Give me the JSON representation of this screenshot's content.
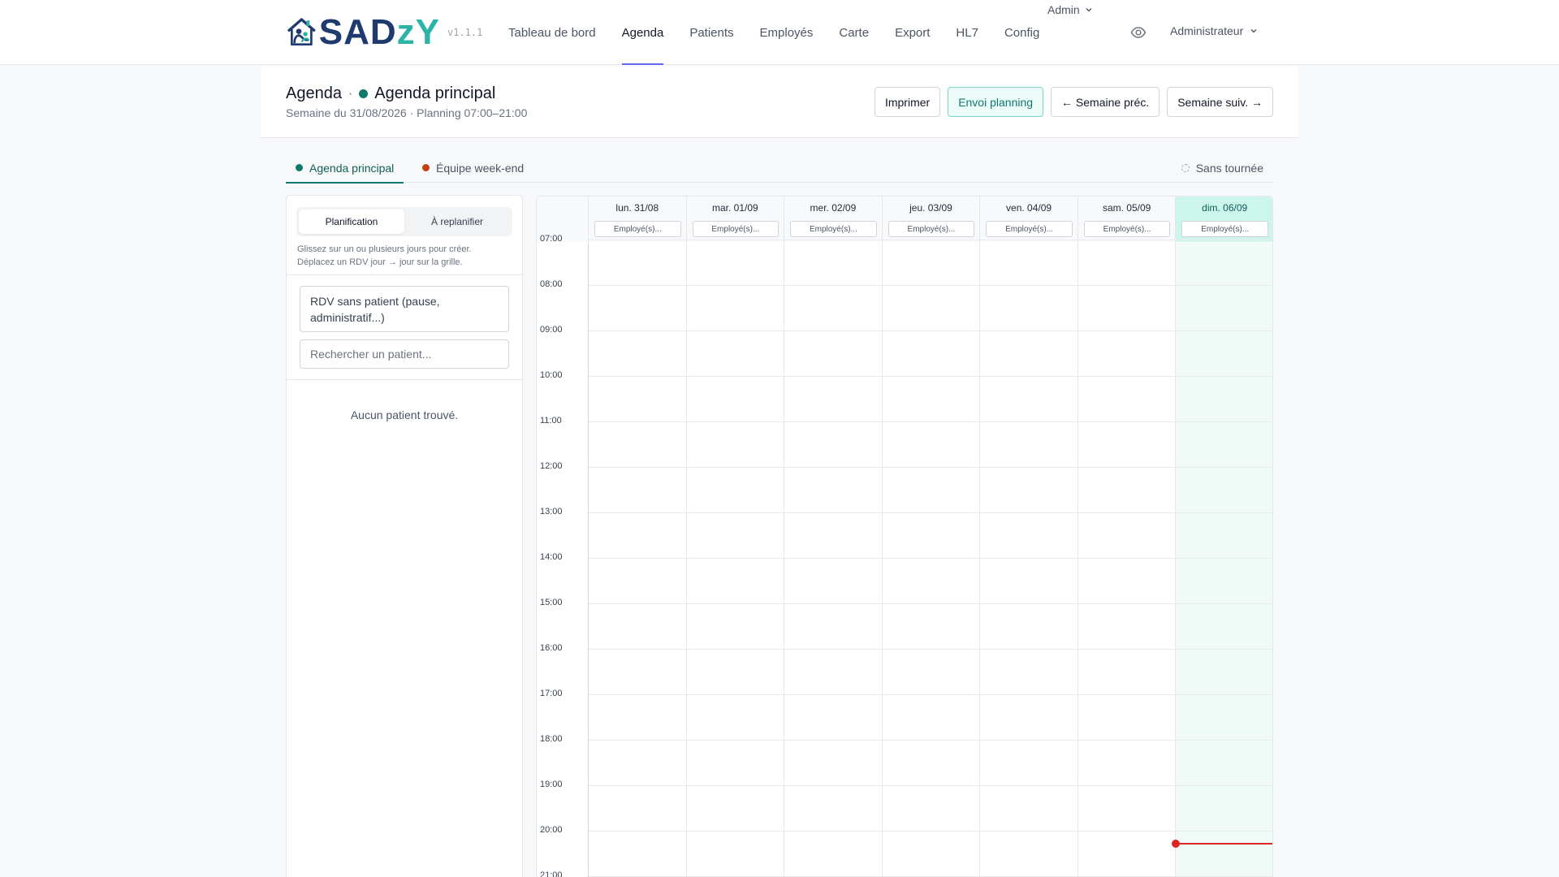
{
  "app": {
    "logo_main": "SAD",
    "logo_accent": "zY",
    "version": "v1.1.1"
  },
  "nav": {
    "items": [
      {
        "label": "Tableau de bord"
      },
      {
        "label": "Agenda",
        "active": true
      },
      {
        "label": "Patients"
      },
      {
        "label": "Employés"
      },
      {
        "label": "Carte"
      },
      {
        "label": "Export"
      },
      {
        "label": "HL7"
      },
      {
        "label": "Config"
      }
    ],
    "admin_menu": "Admin",
    "user_menu": "Administrateur"
  },
  "header": {
    "title": "Agenda",
    "separator": "·",
    "agenda_name": "Agenda principal",
    "subtitle": "Semaine du 31/08/2026 · Planning 07:00–21:00",
    "buttons": {
      "print": "Imprimer",
      "send": "Envoi planning",
      "prev": "← Semaine préc.",
      "next": "Semaine suiv. →"
    }
  },
  "tabs": {
    "items": [
      {
        "label": "Agenda principal",
        "color": "#0f7a6c",
        "active": true
      },
      {
        "label": "Équipe week-end",
        "color": "#c2410c"
      }
    ],
    "no_tour": "Sans tournée"
  },
  "sidebar": {
    "segments": {
      "planning": "Planification",
      "replan": "À replanifier"
    },
    "hint_line1": "Glissez sur un ou plusieurs jours pour créer.",
    "hint_line2": "Déplacez un RDV jour → jour sur la grille.",
    "rdv_no_patient": "RDV sans patient (pause, administratif...)",
    "search_placeholder": "Rechercher un patient...",
    "empty_message": "Aucun patient trouvé."
  },
  "calendar": {
    "days": [
      {
        "label": "lun. 31/08",
        "employee": "Employé(s)..."
      },
      {
        "label": "mar. 01/09",
        "employee": "Employé(s)..."
      },
      {
        "label": "mer. 02/09",
        "employee": "Employé(s)..."
      },
      {
        "label": "jeu. 03/09",
        "employee": "Employé(s)..."
      },
      {
        "label": "ven. 04/09",
        "employee": "Employé(s)..."
      },
      {
        "label": "sam. 05/09",
        "employee": "Employé(s)..."
      },
      {
        "label": "dim. 06/09",
        "employee": "Employé(s)...",
        "today": true
      }
    ],
    "hours": [
      "07:00",
      "08:00",
      "09:00",
      "10:00",
      "11:00",
      "12:00",
      "13:00",
      "14:00",
      "15:00",
      "16:00",
      "17:00",
      "18:00",
      "19:00",
      "20:00",
      "21:00"
    ],
    "current_time": "20:17",
    "accent_color": "#0f7a6c",
    "now_color": "#dc2626"
  }
}
